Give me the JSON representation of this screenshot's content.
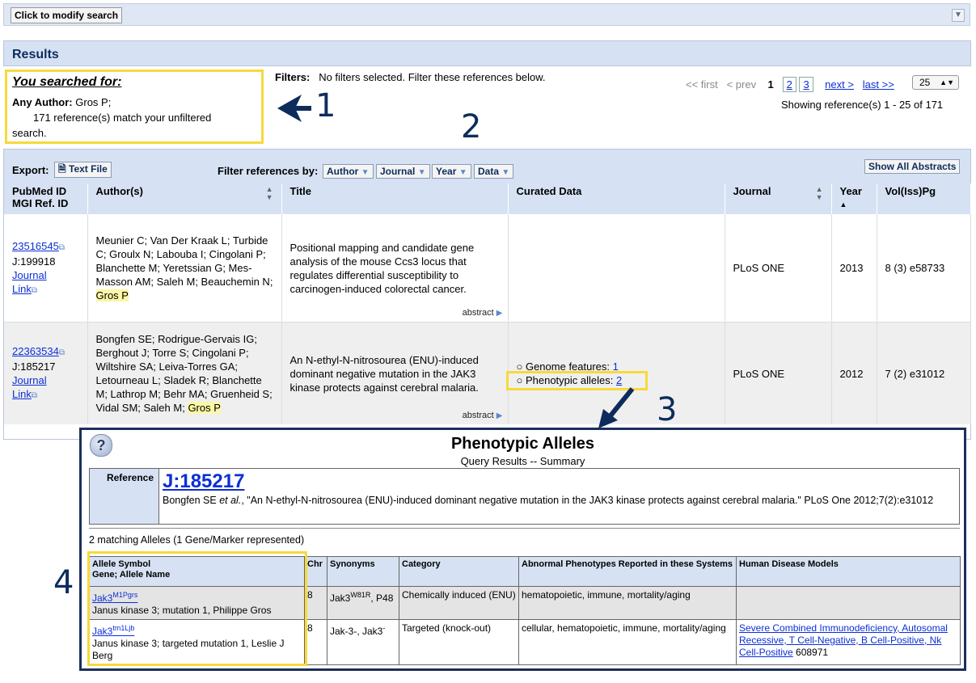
{
  "top": {
    "modify_button": "Click to modify search"
  },
  "results": {
    "title": "Results"
  },
  "searched": {
    "title": "You searched for:",
    "author_label": "Any Author:",
    "author_value": "Gros P;",
    "match_line1": "171 reference(s) match your unfiltered",
    "match_line2": "search."
  },
  "filters": {
    "label": "Filters:",
    "text": "No filters selected. Filter these references below."
  },
  "paging": {
    "first": "<< first",
    "prev": "< prev",
    "p1": "1",
    "p2": "2",
    "p3": "3",
    "next": "next >",
    "last": "last >>",
    "per_page": "25",
    "showing": "Showing reference(s) 1 - 25 of 171"
  },
  "callouts": {
    "c1": "1",
    "c2": "2",
    "c3": "3",
    "c4": "4"
  },
  "toolbar": {
    "export_label": "Export:",
    "text_file": "Text File",
    "filter_label": "Filter references by:",
    "f_author": "Author",
    "f_journal": "Journal",
    "f_year": "Year",
    "f_data": "Data",
    "show_abstracts": "Show All Abstracts"
  },
  "columns": {
    "pubmed": "PubMed ID",
    "mgi": "MGI Ref. ID",
    "authors": "Author(s)",
    "title": "Title",
    "curated": "Curated Data",
    "journal": "Journal",
    "year": "Year",
    "vol": "Vol(Iss)Pg"
  },
  "rows": [
    {
      "pubmed": "23516545",
      "jnum": "J:199918",
      "link1": "Journal",
      "link2": "Link",
      "authors_a": "Meunier C; Van Der Kraak L; Turbide C; Groulx N; Labouba I; Cingolani P; Blanchette M; Yeretssian G; Mes-Masson AM; Saleh M; Beauchemin N;",
      "authors_hl": "Gros P",
      "title": "Positional mapping and candidate gene analysis of the mouse Ccs3 locus that regulates differential susceptibility to carcinogen-induced colorectal cancer.",
      "abstract": "abstract",
      "journal": "PLoS ONE",
      "year": "2013",
      "vol": "8 (3) e58733"
    },
    {
      "pubmed": "22363534",
      "jnum": "J:185217",
      "link1": "Journal",
      "link2": "Link",
      "authors_a": "Bongfen SE; Rodrigue-Gervais IG; Berghout J; Torre S; Cingolani P; Wiltshire SA; Leiva-Torres GA; Letourneau L; Sladek R; Blanchette M; Lathrop M; Behr MA; Gruenheid S; Vidal SM; Saleh M;",
      "authors_hl": "Gros P",
      "title": "An N-ethyl-N-nitrosourea (ENU)-induced dominant negative mutation in the JAK3 kinase protects against cerebral malaria.",
      "abstract": "abstract",
      "curated1_label": "Genome features:",
      "curated1_value": "1",
      "curated2_label": "Phenotypic alleles:",
      "curated2_value": "2",
      "journal": "PLoS ONE",
      "year": "2012",
      "vol": "7 (2) e31012"
    }
  ],
  "popup": {
    "help": "?",
    "title": "Phenotypic Alleles",
    "subtitle": "Query Results -- Summary",
    "ref_label": "Reference",
    "ref_jnum": "J:185217",
    "ref_cite_a": "Bongfen SE",
    "ref_cite_etal": "et al.",
    "ref_cite_b": ", \"An N-ethyl-N-nitrosourea (ENU)-induced dominant negative mutation in the JAK3 kinase protects against cerebral malaria.\" PLoS One 2012;7(2):e31012",
    "match_count": "2 matching Alleles (1 Gene/Marker represented)",
    "cols": {
      "symbol_a": "Allele Symbol",
      "symbol_b": "Gene; Allele Name",
      "chr": "Chr",
      "syn": "Synonyms",
      "cat": "Category",
      "pheno": "Abnormal Phenotypes Reported in these Systems",
      "disease": "Human Disease Models"
    },
    "alleles": [
      {
        "sym": "Jak3",
        "sup": "M1Pgrs",
        "name": "Janus kinase 3; mutation 1, Philippe Gros",
        "chr": "8",
        "syn_a": "Jak3",
        "syn_sup": "W81R",
        "syn_b": ", P48",
        "cat": "Chemically induced (ENU)",
        "pheno": "hematopoietic, immune, mortality/aging",
        "disease": ""
      },
      {
        "sym": "Jak3",
        "sup": "tm1Ljb",
        "name": "Janus kinase 3; targeted mutation 1, Leslie J Berg",
        "chr": "8",
        "syn_a": "Jak-3-, Jak3",
        "syn_sup": "-",
        "syn_b": "",
        "cat": "Targeted (knock-out)",
        "pheno": "cellular, hematopoietic, immune, mortality/aging",
        "disease": "Severe Combined Immunodeficiency, Autosomal Recessive, T Cell-Negative, B Cell-Positive, Nk Cell-Positive",
        "disease_id": "608971"
      }
    ]
  }
}
